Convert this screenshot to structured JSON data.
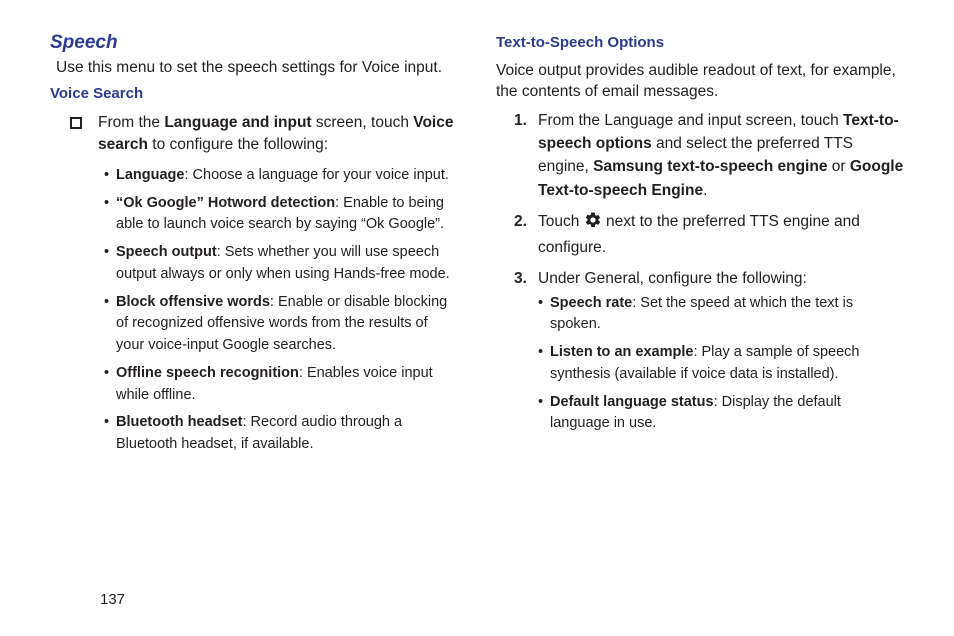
{
  "left": {
    "section_title": "Speech",
    "intro": "Use this menu to set the speech settings for Voice input.",
    "sub1_title": "Voice Search",
    "square_item": {
      "pre": "From the ",
      "b1": "Language and input",
      "mid": " screen, touch ",
      "b2": "Voice search",
      "post": " to configure the following:"
    },
    "bullets": [
      {
        "b": "Language",
        "t": ": Choose a language for your voice input."
      },
      {
        "b": "“Ok Google” Hotword detection",
        "t": ": Enable to being able to launch voice search by saying “Ok Google”."
      },
      {
        "b": "Speech output",
        "t": ": Sets whether you will use speech output always or only when using Hands-free mode."
      },
      {
        "b": "Block offensive words",
        "t": ": Enable or disable blocking of recognized offensive words from the results of your voice-input Google searches."
      },
      {
        "b": "Offline speech recognition",
        "t": ": Enables voice input while offline."
      },
      {
        "b": "Bluetooth headset",
        "t": ": Record audio through a Bluetooth headset, if available."
      }
    ]
  },
  "right": {
    "sub_title": "Text-to-Speech Options",
    "intro": "Voice output provides audible readout of text, for example, the contents of email messages.",
    "step1": {
      "pre": "From the Language and input screen, touch ",
      "b1": "Text-to-speech options",
      "mid1": " and select the preferred TTS engine, ",
      "b2": "Samsung text-to-speech engine",
      "mid2": " or ",
      "b3": "Google Text-to-speech Engine",
      "post": "."
    },
    "step2": {
      "pre": "Touch ",
      "post": " next to the preferred TTS engine and configure."
    },
    "step3": {
      "pre": "Under General, configure the following:",
      "bullets": [
        {
          "b": "Speech rate",
          "t": ": Set the speed at which the text is spoken."
        },
        {
          "b": "Listen to an example",
          "t": ": Play a sample of speech synthesis (available if voice data is installed)."
        },
        {
          "b": "Default language status",
          "t": ": Display the default language in use."
        }
      ]
    }
  },
  "page_number": "137"
}
